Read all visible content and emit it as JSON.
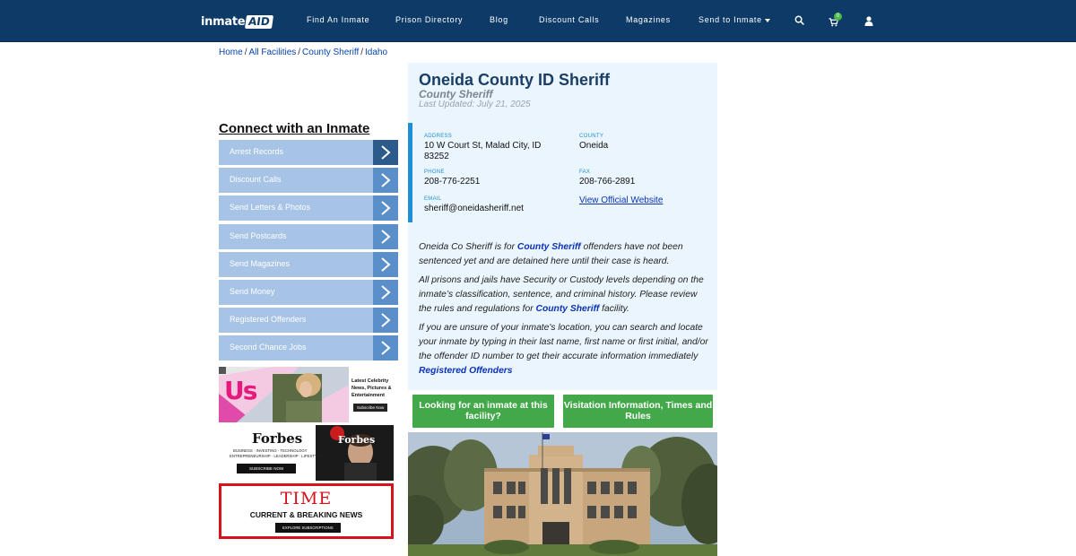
{
  "header": {
    "logo_main": "inmate",
    "logo_accent": "AID",
    "nav": [
      {
        "label": "Find An Inmate"
      },
      {
        "label": "Prison Directory"
      },
      {
        "label": "Blog"
      },
      {
        "label": "Discount Calls"
      },
      {
        "label": "Magazines"
      },
      {
        "label": "Send to Inmate"
      }
    ],
    "cart_count": "0",
    "icons": [
      "search-icon",
      "cart-icon",
      "user-icon"
    ]
  },
  "breadcrumb": [
    {
      "label": "Home"
    },
    {
      "label": "All Facilities"
    },
    {
      "label": "County Sheriff"
    },
    {
      "label": "Idaho"
    }
  ],
  "sidebar": {
    "title": "Connect with an Inmate",
    "items": [
      {
        "label": "Arrest Records"
      },
      {
        "label": "Discount Calls"
      },
      {
        "label": "Send Letters & Photos"
      },
      {
        "label": "Send Postcards"
      },
      {
        "label": "Send Magazines"
      },
      {
        "label": "Send Money"
      },
      {
        "label": "Registered Offenders"
      },
      {
        "label": "Second Chance Jobs"
      }
    ]
  },
  "ads": {
    "us": {
      "logo": "Us",
      "tagline_1": "Latest Celebrity",
      "tagline_2": "News, Pictures &",
      "tagline_3": "Entertainment",
      "cta": "Subscribe Now"
    },
    "forbes": {
      "logo": "Forbes",
      "tagline_1": "BUSINESS · INVESTING · TECHNOLOGY",
      "tagline_2": "ENTREPRENEURSHIP · LEADERSHIP · LIFESTYLE",
      "cta": "SUBSCRIBE NOW",
      "cover_logo": "Forbes"
    },
    "time": {
      "logo": "TIME",
      "tagline": "CURRENT & BREAKING NEWS",
      "cta": "EXPLORE SUBSCRIPTIONS"
    }
  },
  "facility": {
    "name": "Oneida County ID Sheriff",
    "type": "County Sheriff",
    "updated": "Last Updated: July 21, 2025",
    "address_label": "ADDRESS",
    "address_line1": "10 W Court St, Malad City, ID",
    "address_line2": "83252",
    "county_label": "COUNTY",
    "county": "Oneida",
    "phone_label": "PHONE",
    "phone": "208-776-2251",
    "fax_label": "FAX",
    "fax": "208-766-2891",
    "email_label": "EMAIL",
    "email": "sheriff@oneidasheriff.net",
    "website_link": "View Official Website"
  },
  "description": {
    "p1_before": "Oneida Co Sheriff is for ",
    "p1_link": "County Sheriff",
    "p1_after": " offenders have not been sentenced yet and are detained here until their case is heard.",
    "p2_before": "All prisons and jails have Security or Custody levels depending on the inmate’s classification, sentence, and criminal history. Please review the rules and regulations for ",
    "p2_link": "County Sheriff",
    "p2_after": " facility.",
    "p3_before": "If you are unsure of your inmate's location, you can search and locate your inmate by typing in their last name, first name or first initial, and/or the offender ID number to get their accurate information immediately ",
    "p3_link": "Registered Offenders"
  },
  "buttons": {
    "find_inmate": "Looking for an inmate at this facility?",
    "visitation": "Visitation Information, Times and Rules"
  },
  "colors": {
    "navbar": "#0d3a66",
    "sidebar_item": "#a7c4e6",
    "sidebar_arrow": "#5b8fc9",
    "card_bg": "#eaf5fd",
    "accent_blue": "#1e8fd6",
    "green": "#43a84a",
    "link": "#0b32b7"
  }
}
